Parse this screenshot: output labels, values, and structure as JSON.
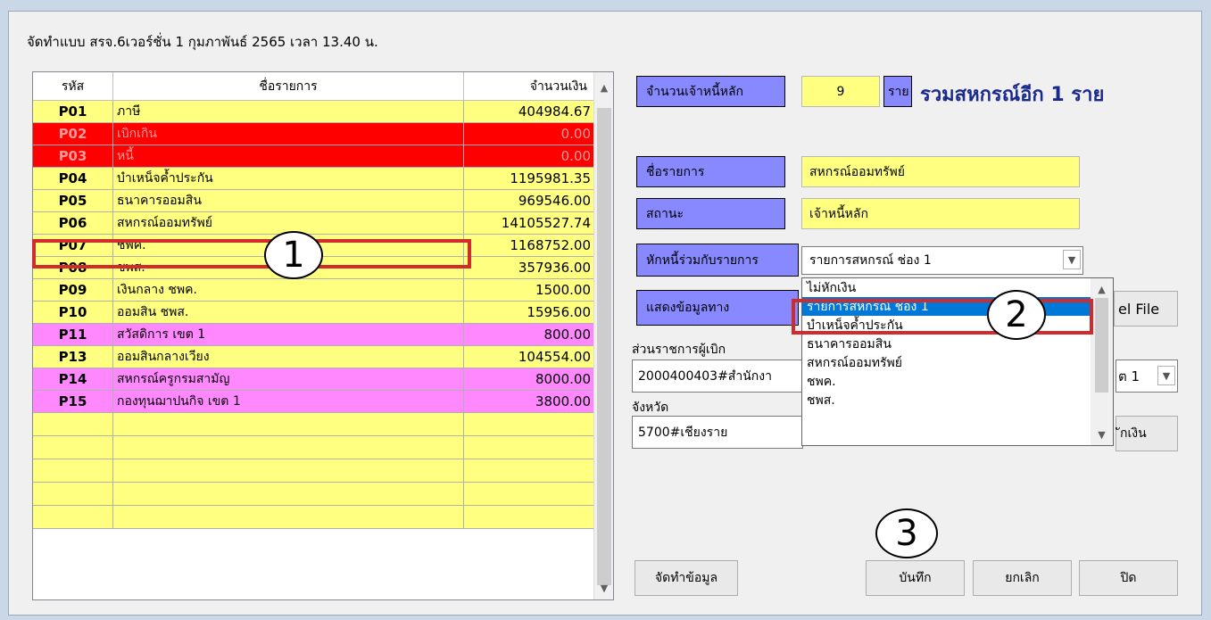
{
  "window": {
    "title": "จัดทำแบบ สรจ.6เวอร์ชั่น 1 กุมภาพันธ์ 2565 เวลา 13.40 น."
  },
  "grid": {
    "headers": [
      "รหัส",
      "ชื่อรายการ",
      "จำนวนเงิน"
    ],
    "rows": [
      {
        "code": "P01",
        "name": "ภาษี",
        "amount": "404984.67",
        "color": "#ffff80"
      },
      {
        "code": "P02",
        "name": "เบิกเกิน",
        "amount": "0.00",
        "color": "#ff0000"
      },
      {
        "code": "P03",
        "name": "หนี้",
        "amount": "0.00",
        "color": "#ff0000"
      },
      {
        "code": "P04",
        "name": "บำเหน็จค้ำประกัน",
        "amount": "1195981.35",
        "color": "#ffff80"
      },
      {
        "code": "P05",
        "name": "ธนาคารออมสิน",
        "amount": "969546.00",
        "color": "#ffff80"
      },
      {
        "code": "P06",
        "name": "สหกรณ์ออมทรัพย์",
        "amount": "14105527.74",
        "color": "#ffff80"
      },
      {
        "code": "P07",
        "name": "ชพค.",
        "amount": "1168752.00",
        "color": "#ffff80"
      },
      {
        "code": "P08",
        "name": "ชพส.",
        "amount": "357936.00",
        "color": "#ffff80"
      },
      {
        "code": "P09",
        "name": "เงินกลาง ชพค.",
        "amount": "1500.00",
        "color": "#ffff80"
      },
      {
        "code": "P10",
        "name": "ออมสิน ชพส.",
        "amount": "15956.00",
        "color": "#ffff80"
      },
      {
        "code": "P11",
        "name": "สวัสดิการ เขต 1",
        "amount": "800.00",
        "color": "#ff88ff"
      },
      {
        "code": "P13",
        "name": "ออมสินกลางเวียง",
        "amount": "104554.00",
        "color": "#ffff80"
      },
      {
        "code": "P14",
        "name": "สหกรณ์ครูกรมสามัญ",
        "amount": "8000.00",
        "color": "#ff88ff"
      },
      {
        "code": "P15",
        "name": "กองทุนฌาปนกิจ เขต 1",
        "amount": "3800.00",
        "color": "#ff88ff"
      }
    ]
  },
  "form": {
    "creditor_count_label": "จำนวนเจ้าหนี้หลัก",
    "creditor_count": "9",
    "unit": "ราย",
    "summary": "รวมสหกรณ์อีก 1 ราย",
    "item_name_label": "ชื่อรายการ",
    "item_name": "สหกรณ์ออมทรัพย์",
    "status_label": "สถานะ",
    "status": "เจ้าหนี้หลัก",
    "combine_label": "หักหนี้ร่วมกับรายการ",
    "combine_value": "รายการสหกรณ์ ช่อง 1",
    "show_data_label": "แสดงข้อมูลทาง",
    "excel_btn_partial": "el File",
    "agency_label": "ส่วนราชการผู้เบิก",
    "agency_value": "2000400403#สำนักงา",
    "zone_partial": "ต 1",
    "province_label": "จังหวัด",
    "province_value": "5700#เชียงราย",
    "money_btn_partial": "ักเงิน"
  },
  "dropdown": {
    "options": [
      "ไม่หักเงิน",
      "รายการสหกรณ์ ช่อง 1",
      "บำเหน็จค้ำประกัน",
      "ธนาคารออมสิน",
      "สหกรณ์ออมทรัพย์",
      "ชพค.",
      "ชพส."
    ],
    "selected_index": 1
  },
  "buttons": {
    "prepare": "จัดทำข้อมูล",
    "save": "บันทึก",
    "cancel": "ยกเลิก",
    "close": "ปิด"
  },
  "annotations": {
    "step1": "1",
    "step2": "2",
    "step3": "3"
  },
  "colors": {
    "label_bg": "#8888ff",
    "field_bg": "#ffff80",
    "highlight": "#d22b2b",
    "select_bg": "#0078d7"
  }
}
